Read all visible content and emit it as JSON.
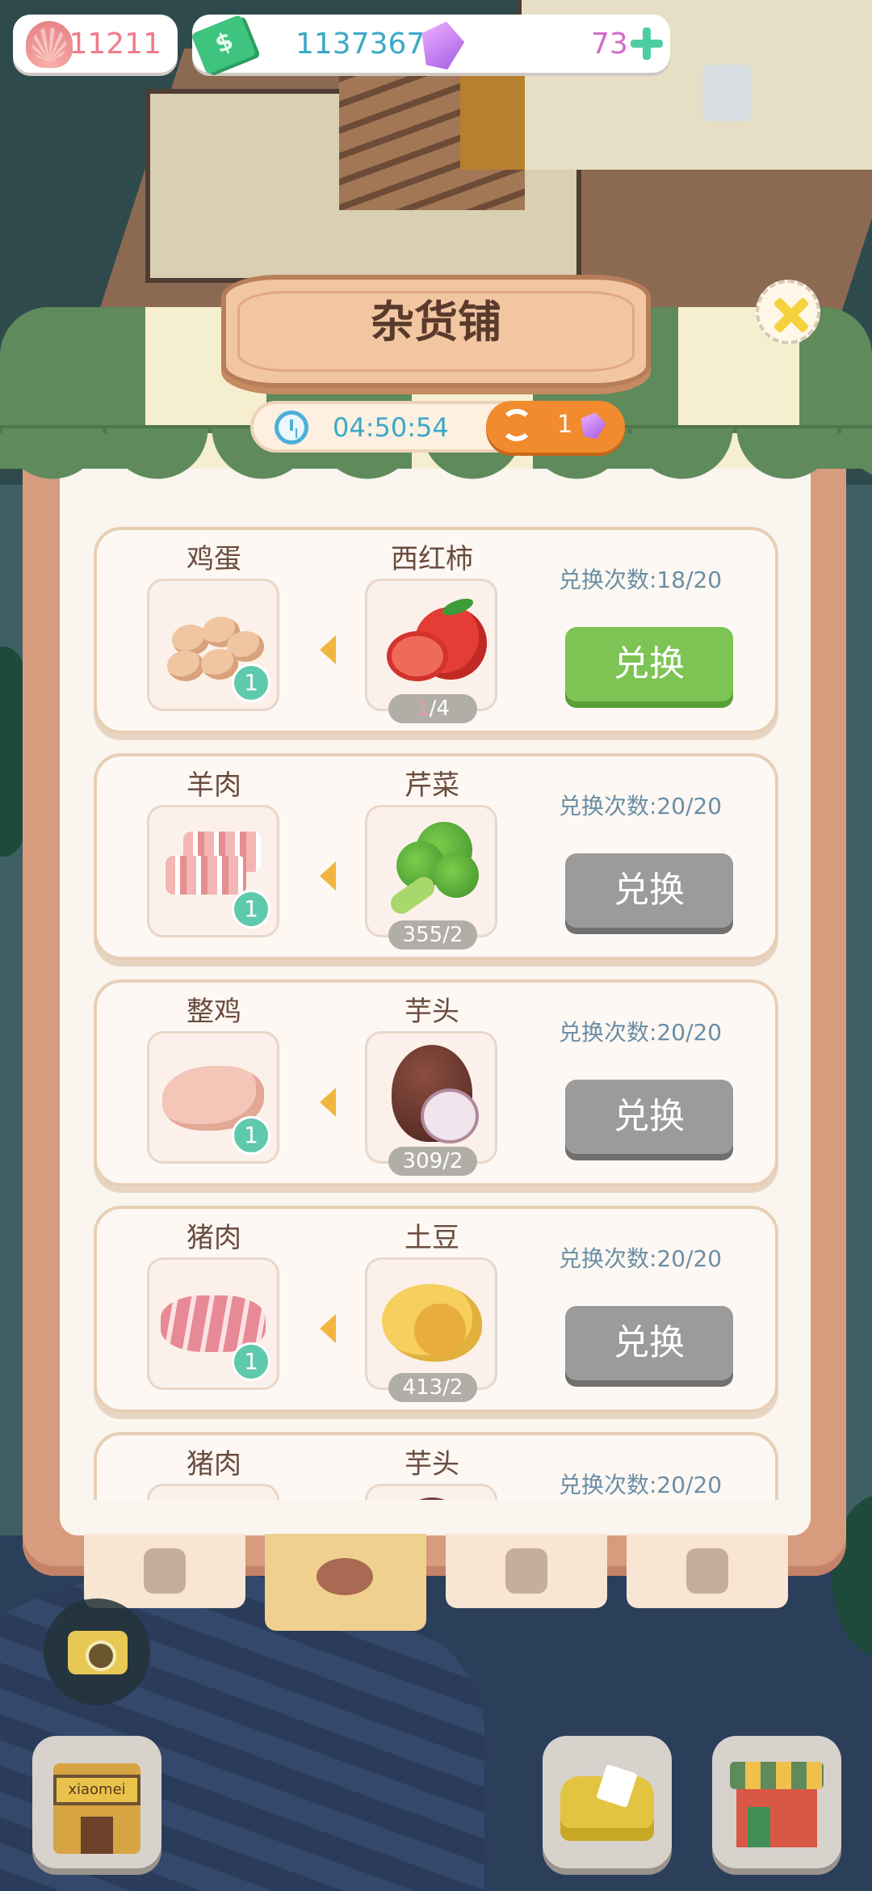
{
  "hud": {
    "shells": "11211",
    "cash": "11373676",
    "gems": "73"
  },
  "shop": {
    "title": "杂货铺",
    "timer": "04:50:54",
    "refresh_cost": "1"
  },
  "trades": [
    {
      "give_name": "鸡蛋",
      "give_qty": "1",
      "get_name": "西红柿",
      "stock_have": "1",
      "stock_need": "/4",
      "limit": "兑换次数:18/20",
      "button": "兑换",
      "enabled": true
    },
    {
      "give_name": "羊肉",
      "give_qty": "1",
      "get_name": "芹菜",
      "stock": "355/2",
      "limit": "兑换次数:20/20",
      "button": "兑换",
      "enabled": false
    },
    {
      "give_name": "整鸡",
      "give_qty": "1",
      "get_name": "芋头",
      "stock": "309/2",
      "limit": "兑换次数:20/20",
      "button": "兑换",
      "enabled": false
    },
    {
      "give_name": "猪肉",
      "give_qty": "1",
      "get_name": "土豆",
      "stock": "413/2",
      "limit": "兑换次数:20/20",
      "button": "兑换",
      "enabled": false
    },
    {
      "give_name": "猪肉",
      "get_name": "芋头",
      "limit": "兑换次数:20/20"
    }
  ],
  "tabs": [
    {
      "icon": "soy-sauce-bottle-icon"
    },
    {
      "icon": "meat-icon",
      "active": true
    },
    {
      "icon": "grain-sack-icon"
    },
    {
      "icon": "honey-pot-icon"
    }
  ],
  "bottom": {
    "home_sign": "xiaomei"
  }
}
